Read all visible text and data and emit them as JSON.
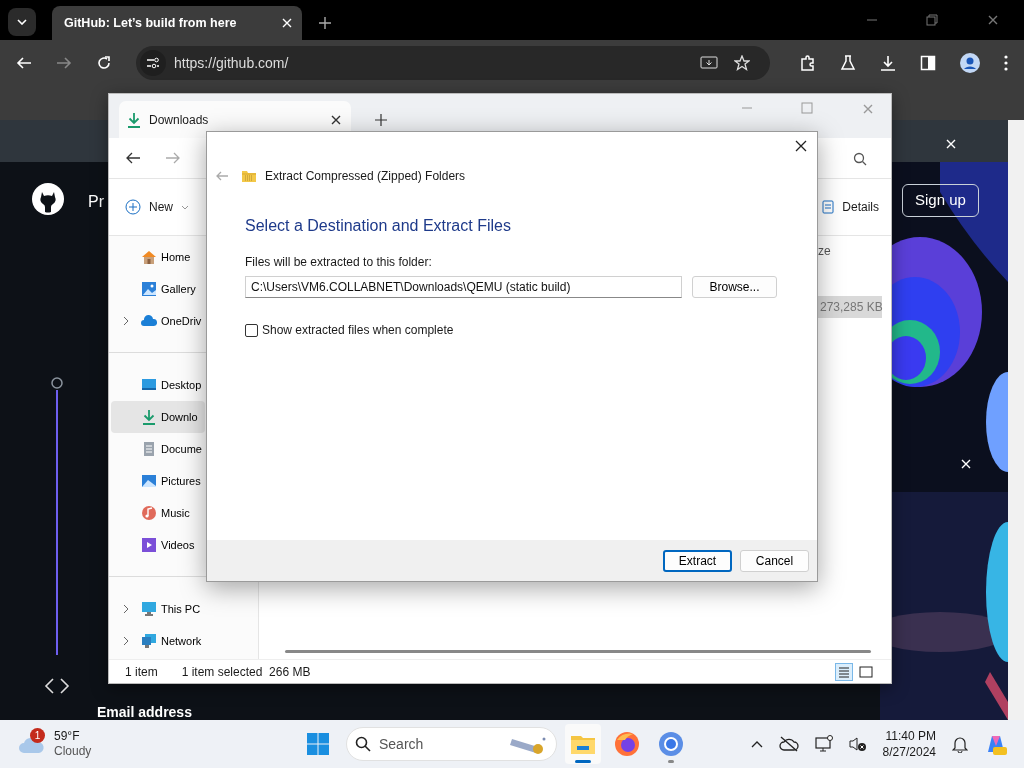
{
  "browser": {
    "tabs": [
      {
        "title": "GitHub: Let’s build from here",
        "selected": true
      }
    ],
    "url": "https://github.com/"
  },
  "github": {
    "nav_text": "Pr",
    "sign_up": "Sign up",
    "email_label": "Email address"
  },
  "explorer": {
    "tab_title": "Downloads",
    "new_label": "New",
    "details_label": "Details",
    "column_header": "ze",
    "sidebar": [
      {
        "items": [
          {
            "label": "Home",
            "expandable": false,
            "selected": false
          },
          {
            "label": "Gallery",
            "expandable": false,
            "selected": false
          },
          {
            "label": "OneDriv",
            "expandable": true,
            "selected": false
          }
        ]
      },
      {
        "items": [
          {
            "label": "Desktop",
            "expandable": false,
            "selected": false
          },
          {
            "label": "Downlo",
            "expandable": false,
            "selected": true
          },
          {
            "label": "Docume",
            "expandable": false,
            "selected": false
          },
          {
            "label": "Pictures",
            "expandable": false,
            "selected": false
          },
          {
            "label": "Music",
            "expandable": false,
            "selected": false
          },
          {
            "label": "Videos",
            "expandable": false,
            "selected": false
          }
        ]
      },
      {
        "items": [
          {
            "label": "This PC",
            "expandable": true,
            "selected": false
          },
          {
            "label": "Network",
            "expandable": true,
            "selected": false
          }
        ]
      }
    ],
    "rows": [
      {
        "size": "273,285 KB",
        "selected": true
      }
    ],
    "status_bar": {
      "count": "1 item",
      "selection": "1 item selected",
      "size": "266 MB"
    },
    "views": [
      {
        "kind": "details",
        "selected": true
      },
      {
        "kind": "tiles",
        "selected": false
      }
    ]
  },
  "dialog": {
    "title": "Extract Compressed (Zipped) Folders",
    "heading": "Select a Destination and Extract Files",
    "field_label": "Files will be extracted to this folder:",
    "path": "C:\\Users\\VM6.COLLABNET\\Downloads\\QEMU (static build)",
    "browse": "Browse...",
    "checkbox": {
      "label": "Show extracted files when complete",
      "checked": false
    },
    "buttons": [
      {
        "label": "Extract",
        "default": true
      },
      {
        "label": "Cancel",
        "default": false
      }
    ]
  },
  "taskbar": {
    "weather": {
      "badge": "1",
      "temp": "59°F",
      "condition": "Cloudy"
    },
    "search_placeholder": "Search",
    "apps": [
      {
        "kind": "explorer",
        "active": true,
        "running": true
      },
      {
        "kind": "firefox",
        "active": false,
        "running": false
      },
      {
        "kind": "chrome",
        "active": false,
        "running": true
      }
    ],
    "clock": {
      "time": "11:40 PM",
      "date": "8/27/2024"
    }
  }
}
